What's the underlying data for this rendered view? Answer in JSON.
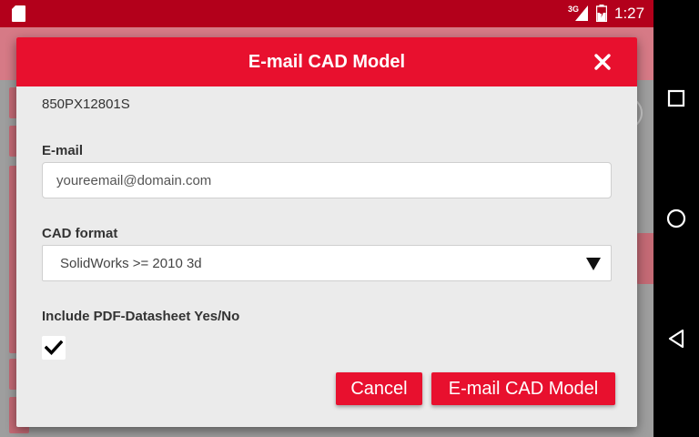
{
  "status_bar": {
    "network_label": "3G",
    "time": "1:27"
  },
  "dialog": {
    "title": "E-mail CAD Model",
    "part_number": "850PX12801S",
    "email_label": "E-mail",
    "email_value": "youreemail@domain.com",
    "cad_format_label": "CAD format",
    "cad_format_value": "SolidWorks >= 2010 3d",
    "pdf_label": "Include PDF-Datasheet Yes/No",
    "pdf_checked": true,
    "cancel_label": "Cancel",
    "submit_label": "E-mail CAD Model"
  },
  "colors": {
    "accent": "#e8102e",
    "status_bar": "#b3001b",
    "dialog_bg": "#ebebeb"
  },
  "icons": {
    "status": [
      "sd-card-icon",
      "signal-icon",
      "battery-icon"
    ],
    "dialog": [
      "close-icon",
      "dropdown-caret-icon",
      "checkmark-icon"
    ],
    "nav": [
      "recents-icon",
      "home-icon",
      "back-icon"
    ]
  }
}
